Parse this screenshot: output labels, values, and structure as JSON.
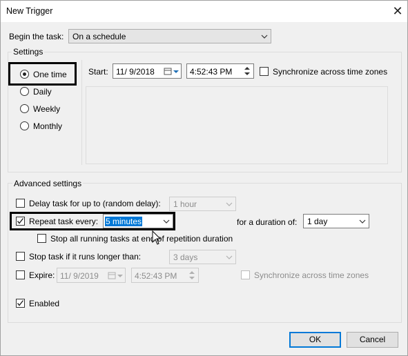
{
  "window": {
    "title": "New Trigger"
  },
  "begin": {
    "label": "Begin the task:",
    "value": "On a schedule"
  },
  "settings": {
    "label": "Settings",
    "options": [
      "One time",
      "Daily",
      "Weekly",
      "Monthly"
    ],
    "selected": "One time",
    "start_label": "Start:",
    "start_date": "11/ 9/2018",
    "start_time": "4:52:43 PM",
    "sync_label": "Synchronize across time zones"
  },
  "advanced": {
    "label": "Advanced settings",
    "delay_label": "Delay task for up to (random delay):",
    "delay_value": "1 hour",
    "repeat_label": "Repeat task every:",
    "repeat_value": "5 minutes",
    "duration_label": "for a duration of:",
    "duration_value": "1 day",
    "stop_all_label": "Stop all running tasks at end of repetition duration",
    "stop_if_label": "Stop task if it runs longer than:",
    "stop_if_value": "3 days",
    "expire_label": "Expire:",
    "expire_date": "11/ 9/2019",
    "expire_time": "4:52:43 PM",
    "expire_sync_label": "Synchronize across time zones",
    "enabled_label": "Enabled"
  },
  "buttons": {
    "ok": "OK",
    "cancel": "Cancel"
  }
}
